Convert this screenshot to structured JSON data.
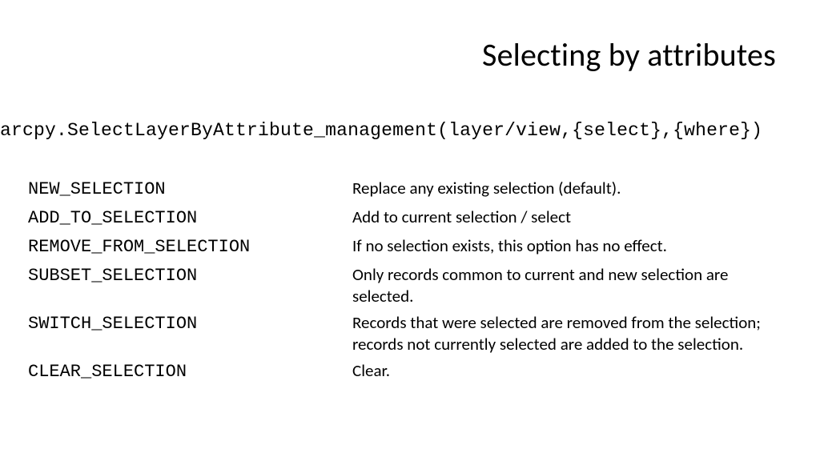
{
  "title": "Selecting by attributes",
  "syntax": "arcpy.SelectLayerByAttribute_management(layer/view,{select},{where})",
  "rows": [
    {
      "key": "NEW_SELECTION",
      "desc": "Replace any existing selection (default)."
    },
    {
      "key": "ADD_TO_SELECTION",
      "desc": "Add to current selection / select"
    },
    {
      "key": "REMOVE_FROM_SELECTION",
      "desc": "If no selection exists, this option has no effect."
    },
    {
      "key": "SUBSET_SELECTION",
      "desc": "Only records common to current and new selection are selected."
    },
    {
      "key": "SWITCH_SELECTION",
      "desc": "Records that were selected are removed from the selection;  records not currently selected are added to the selection."
    },
    {
      "key": "CLEAR_SELECTION",
      "desc": "Clear."
    }
  ]
}
